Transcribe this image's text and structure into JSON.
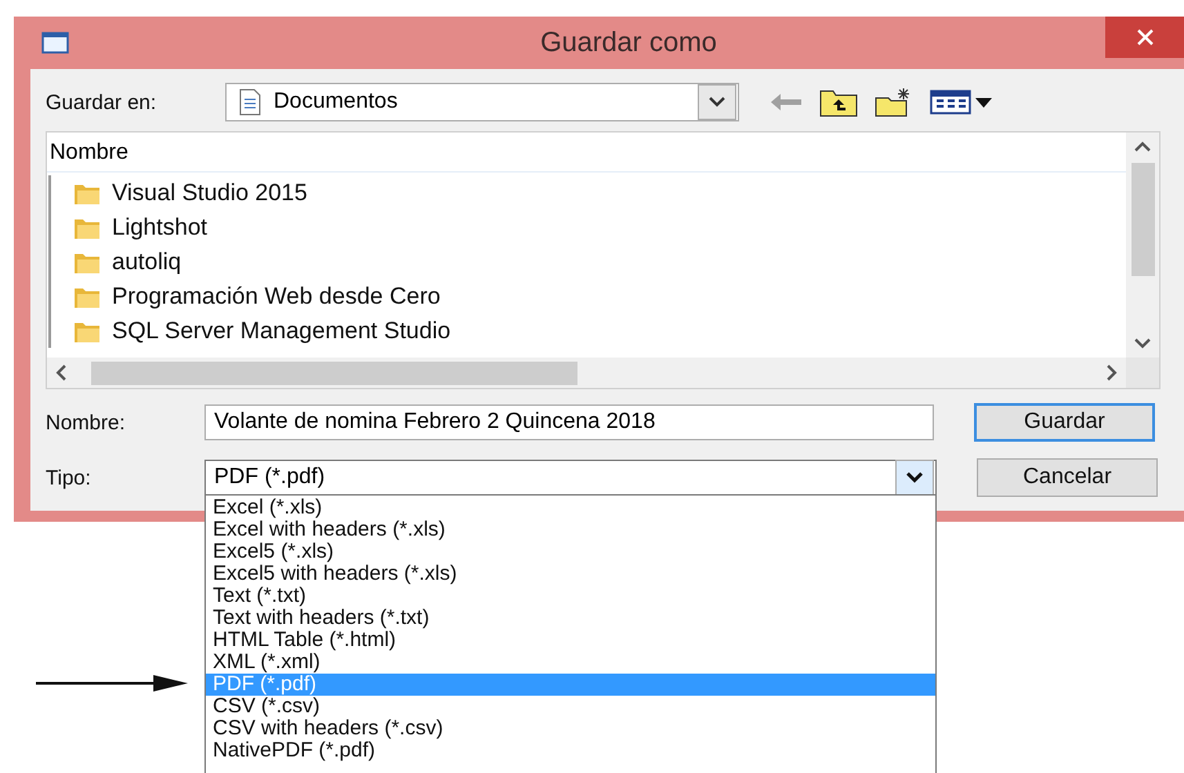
{
  "window": {
    "title": "Guardar como"
  },
  "save_in": {
    "label": "Guardar en:",
    "value": "Documentos"
  },
  "file_list": {
    "column": "Nombre",
    "items": [
      {
        "name": "Visual Studio 2015"
      },
      {
        "name": "Lightshot"
      },
      {
        "name": "autoliq"
      },
      {
        "name": "Programación Web desde Cero"
      },
      {
        "name": "SQL Server Management Studio"
      }
    ]
  },
  "file_name": {
    "label": "Nombre:",
    "value": "Volante de nomina Febrero 2 Quincena 2018"
  },
  "file_type": {
    "label": "Tipo:",
    "value": "PDF (*.pdf)",
    "expanded": true,
    "options": [
      {
        "label": "Excel (*.xls)",
        "selected": false
      },
      {
        "label": "Excel with headers (*.xls)",
        "selected": false
      },
      {
        "label": "Excel5 (*.xls)",
        "selected": false
      },
      {
        "label": "Excel5 with headers (*.xls)",
        "selected": false
      },
      {
        "label": "Text (*.txt)",
        "selected": false
      },
      {
        "label": "Text with headers (*.txt)",
        "selected": false
      },
      {
        "label": "HTML Table (*.html)",
        "selected": false
      },
      {
        "label": "XML (*.xml)",
        "selected": false
      },
      {
        "label": "PDF (*.pdf)",
        "selected": true
      },
      {
        "label": "CSV (*.csv)",
        "selected": false
      },
      {
        "label": "CSV with headers (*.csv)",
        "selected": false
      },
      {
        "label": "NativePDF (*.pdf)",
        "selected": false
      }
    ]
  },
  "buttons": [
    {
      "label": "Guardar",
      "default": true
    },
    {
      "label": "Cancelar",
      "default": false
    }
  ]
}
